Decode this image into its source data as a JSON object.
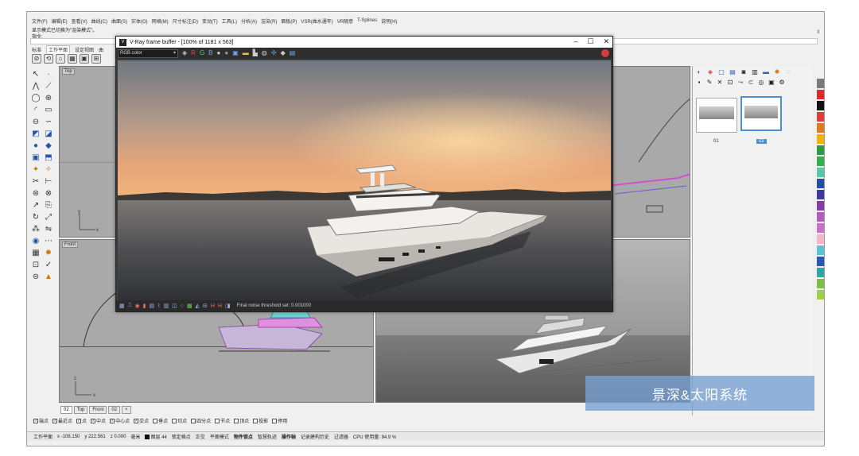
{
  "menu": [
    "文件(F)",
    "编辑(E)",
    "查看(V)",
    "曲线(C)",
    "曲面(S)",
    "实体(O)",
    "网格(M)",
    "尺寸标注(D)",
    "变动(T)",
    "工具(L)",
    "分析(A)",
    "渲染(R)",
    "面板(P)",
    "VSR(曲水通年)",
    "VR随意",
    "T-Splines",
    "说明(H)"
  ],
  "command": {
    "history": "显示模式已切换为\"渲染模式\"。",
    "prompt": "指令:"
  },
  "toolbar_tabs": [
    "标准",
    "工作平面",
    "设定视图",
    "曲"
  ],
  "viewports": {
    "top_label": "Top",
    "front_label": "Front"
  },
  "vray": {
    "title": "V-Ray frame buffer - [100% of 1181 x 563]",
    "channel": "RGB color",
    "tools": [
      "R",
      "G",
      "B"
    ],
    "status": "Final noise threshold set: 0.001000"
  },
  "right_panel": {
    "thumb1_label": "01",
    "thumb2_label": "02"
  },
  "viewport_tabs": [
    "02",
    "Top",
    "Front",
    "02",
    "+"
  ],
  "osnaps": [
    {
      "label": "端点",
      "checked": true
    },
    {
      "label": "最近点",
      "checked": true
    },
    {
      "label": "点",
      "checked": true
    },
    {
      "label": "中点",
      "checked": true
    },
    {
      "label": "中心点",
      "checked": true
    },
    {
      "label": "交点",
      "checked": true
    },
    {
      "label": "垂点",
      "checked": false
    },
    {
      "label": "切点",
      "checked": false
    },
    {
      "label": "四分点",
      "checked": false
    },
    {
      "label": "节点",
      "checked": false
    },
    {
      "label": "顶点",
      "checked": false
    },
    {
      "label": "投影",
      "checked": false
    },
    {
      "label": "停用",
      "checked": false
    }
  ],
  "statusbar": {
    "cplane": "工作平面",
    "x": "x -108.150",
    "y": "y 222.561",
    "z": "z 0.000",
    "unit": "毫米",
    "layer": "图层 44",
    "items": [
      "锁定格点",
      "正交",
      "平面模式",
      "物件锁点",
      "智慧轨迹",
      "操作轴",
      "记录建构历史",
      "过滤器"
    ],
    "cpu": "CPU 使用量: 94.9 %"
  },
  "banner": "景深&太阳系统",
  "swatch_colors": [
    "#7a7a7a",
    "#d92b2b",
    "#111111",
    "#e23a3a",
    "#e07a1d",
    "#f0b400",
    "#2e9a44",
    "#34b04a",
    "#5cc6a7",
    "#1f4fa8",
    "#3a3aa0",
    "#8a3aa6",
    "#b25bc0",
    "#c970c9",
    "#f2b6c6",
    "#5bc3d6",
    "#2c58b0",
    "#2aa8a8",
    "#7cc04a",
    "#9bd048"
  ]
}
